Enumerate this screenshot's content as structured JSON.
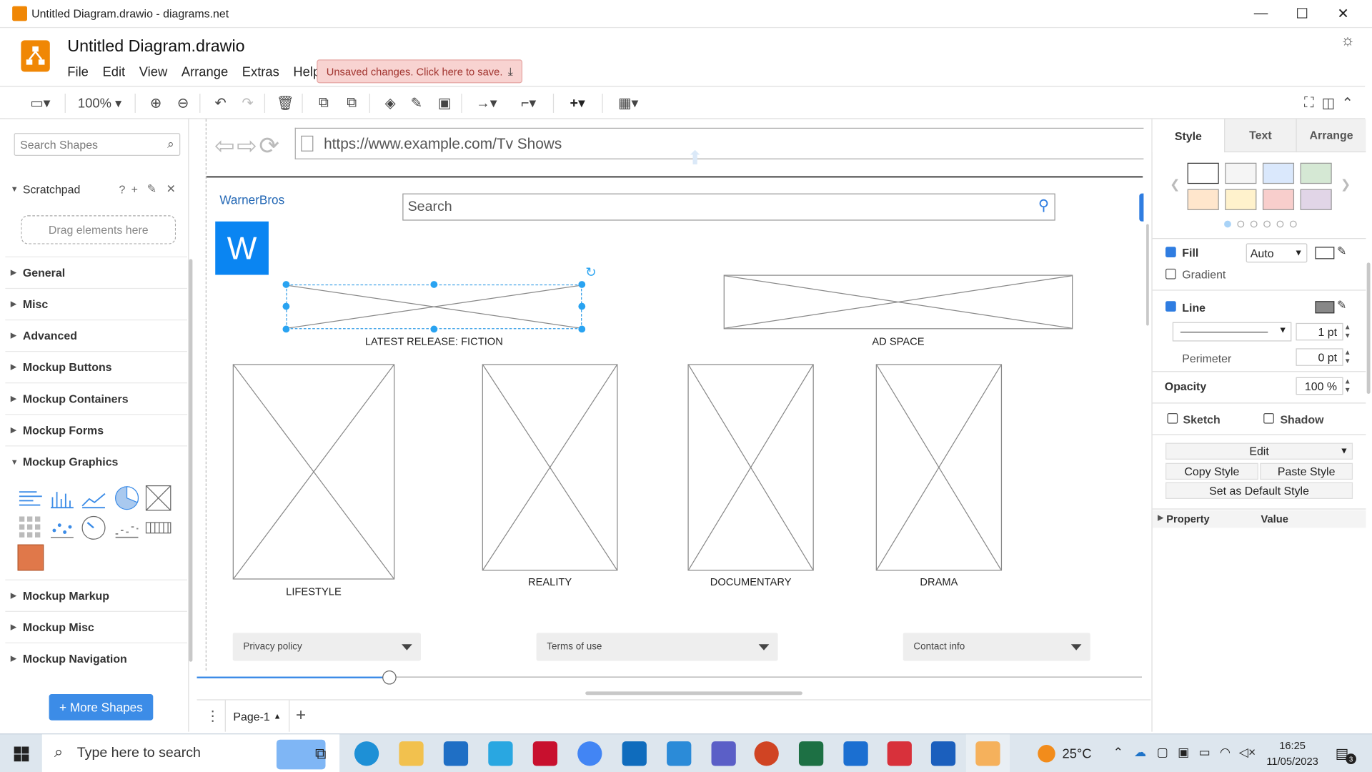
{
  "window": {
    "title": "Untitled Diagram.drawio - diagrams.net",
    "minimize": "—",
    "maximize": "☐",
    "close": "✕"
  },
  "header": {
    "doc_title": "Untitled Diagram.drawio",
    "menu": [
      "File",
      "Edit",
      "View",
      "Arrange",
      "Extras",
      "Help"
    ],
    "unsaved": "Unsaved changes. Click here to save."
  },
  "toolbar": {
    "zoom": "100%"
  },
  "sidebar": {
    "search_placeholder": "Search Shapes",
    "scratchpad": "Scratchpad",
    "scratchpad_help": "?",
    "drag_hint": "Drag elements here",
    "libraries": [
      "General",
      "Misc",
      "Advanced",
      "Mockup Buttons",
      "Mockup Containers",
      "Mockup Forms",
      "Mockup Graphics",
      "Mockup Markup",
      "Mockup Misc",
      "Mockup Navigation"
    ],
    "more_shapes": "+ More Shapes"
  },
  "canvas": {
    "url": "https://www.example.com/Tv Shows",
    "brand_link": "WarnerBros",
    "logo_letter": "W",
    "search_text": "Search",
    "latest_label": "LATEST RELEASE: FICTION",
    "ad_label": "AD SPACE",
    "tiles": [
      "LIFESTYLE",
      "REALITY",
      "DOCUMENTARY",
      "DRAMA"
    ],
    "footer": [
      "Privacy policy",
      "Terms of use",
      "Contact info"
    ]
  },
  "pagebar": {
    "page": "Page-1"
  },
  "rpanel": {
    "tabs": [
      "Style",
      "Text",
      "Arrange"
    ],
    "swatches": [
      "#ffffff",
      "#f5f5f5",
      "#dae8fc",
      "#d5e8d4",
      "#ffe6cc",
      "#fff2cc",
      "#f8cecc",
      "#e1d5e7"
    ],
    "fill_label": "Fill",
    "fill_mode": "Auto",
    "gradient_label": "Gradient",
    "line_label": "Line",
    "line_width": "1 pt",
    "perimeter_label": "Perimeter",
    "perimeter_value": "0 pt",
    "opacity_label": "Opacity",
    "opacity_value": "100 %",
    "sketch_label": "Sketch",
    "shadow_label": "Shadow",
    "edit_label": "Edit",
    "copy_style": "Copy Style",
    "paste_style": "Paste Style",
    "default_style": "Set as Default Style",
    "property_col": "Property",
    "value_col": "Value"
  },
  "taskbar": {
    "search_placeholder": "Type here to search",
    "temperature": "25°C",
    "time": "16:25",
    "date": "11/05/2023",
    "notifications": "3"
  }
}
